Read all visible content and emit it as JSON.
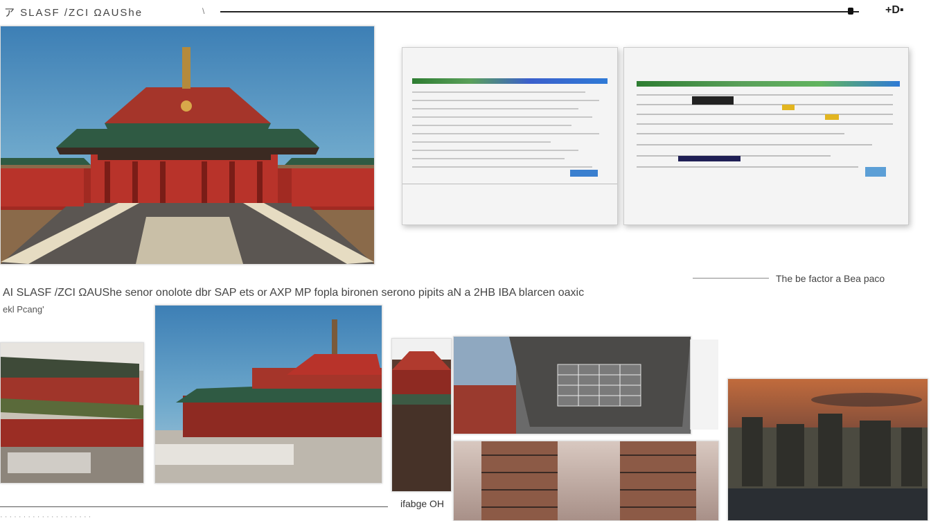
{
  "header": {
    "title": "ア SLASF /ZCI ΩAUShe",
    "marker": "\\",
    "controls": "+D▪"
  },
  "captions": {
    "right_caption": "The be factor a  Bea  paco",
    "description": "AI SLASF /ZCI ΩAUShe  senor  onolote  dbr   SAP ets  or   AXP   MP  fopla  bironen  serono  pipits  aN  a 2HB  IBA  blarcen  oaxic",
    "sub": "ekl Pcang'",
    "bottom": "ifabge OH",
    "bottom_text": "·  ·  ·  ·  ·  ·  ·  ·  ·  ·  ·  ·  ·  ·  ·  ·  ·  ·  ·  ·"
  },
  "images": {
    "hero": "temple-photo",
    "software": "software-screenshot",
    "temple2": "temple-complex-photo",
    "temple3": "temple-gate-photo",
    "temple4": "pagoda-photo",
    "facade": "building-facade-photo",
    "tower": "tower-photo",
    "city": "city-sunset-photo"
  },
  "colors": {
    "temple_red": "#b8332a",
    "roof_green": "#2f5a43",
    "sky_blue": "#3d7fb5"
  }
}
